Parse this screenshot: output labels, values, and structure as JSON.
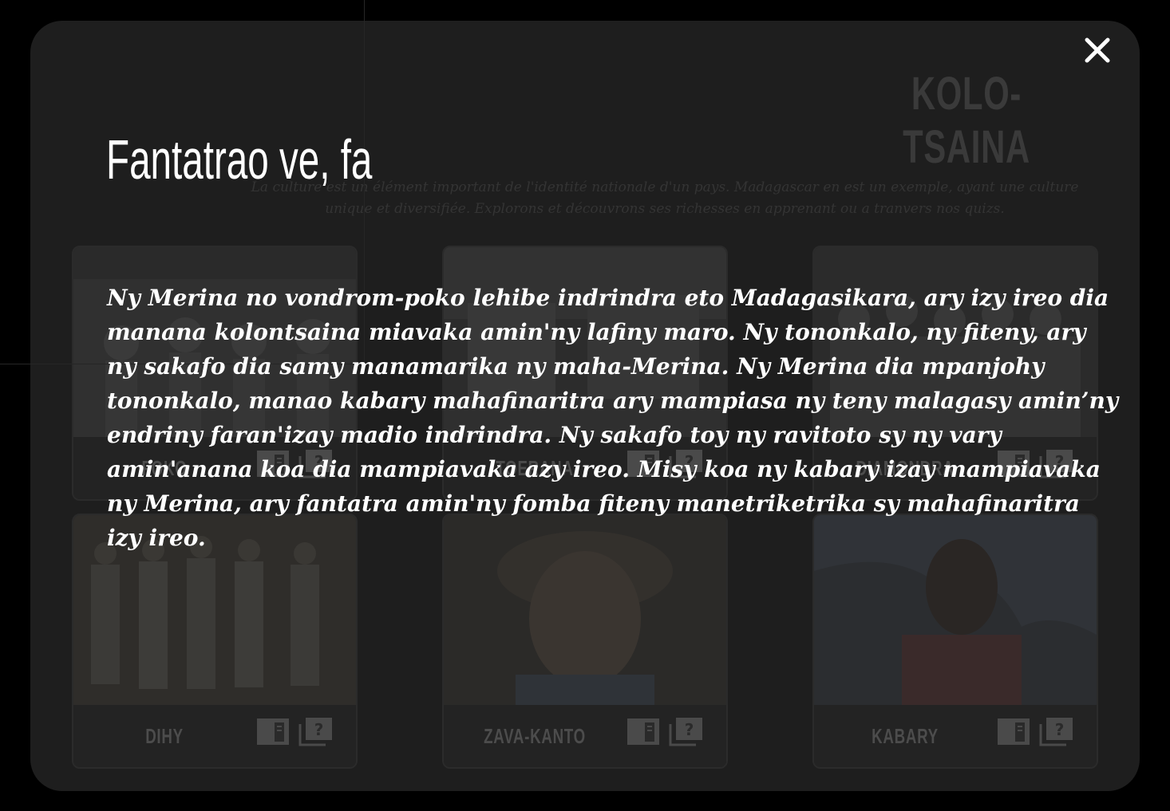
{
  "dialog": {
    "title": "Fantatrao ve, fa",
    "body": "Ny Merina no vondrom-poko lehibe indrindra eto Madagasikara, ary izy ireo dia manana kolontsaina miavaka amin'ny lafiny maro. Ny tononkalo, ny fiteny, ary ny sakafo dia samy manamarika ny maha-Merina. Ny Merina dia mpanjohy tononkalo, manao kabary mahafinaritra ary mampiasa ny teny malagasy amin’ny endriny faran'izay madio indrindra. Ny sakafo toy ny ravitoto sy ny vary amin'anana koa dia mampiavaka azy ireo. Misy koa ny kabary izay mampiavaka ny Merina, ary fantatra amin'ny fomba fiteny manetriketrika sy mahafinaritra izy ireo.",
    "close_icon": "close-icon"
  },
  "page": {
    "heading": "KOLO-TSAINA",
    "intro": "La culture est un élément important de l'identité nationale d'un pays. Madagascar en est un exemple, ayant une culture unique et diversifiée. Explorons et découvrons ses richesses en apprenant ou a tranvers nos quizs."
  },
  "cards": [
    {
      "title": "FOKO",
      "image": "people-photo"
    },
    {
      "title": "TOERANA",
      "image": "landscape-photo"
    },
    {
      "title": "DIAMONDRA",
      "image": "group-photo"
    },
    {
      "title": "DIHY",
      "image": "dancers-illustration"
    },
    {
      "title": "ZAVA-KANTO",
      "image": "child-portrait-illustration"
    },
    {
      "title": "KABARY",
      "image": "orator-illustration"
    }
  ],
  "card_icons": {
    "read": "book-icon",
    "quiz": "quiz-icon"
  },
  "colors": {
    "backdrop": "#000000",
    "frame": "#1e1e1e",
    "card": "#242424",
    "text": "#ffffff",
    "muted": "#4c4c4c"
  }
}
